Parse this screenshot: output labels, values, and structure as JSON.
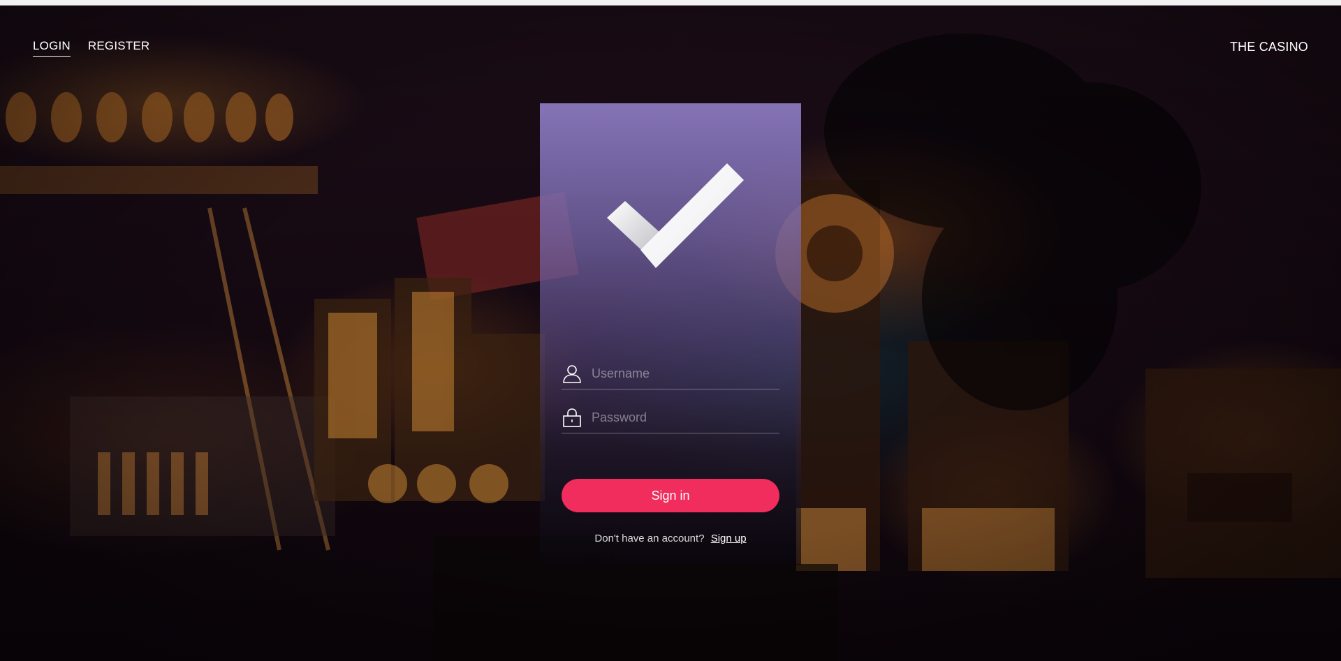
{
  "nav": {
    "login": "LOGIN",
    "register": "REGISTER"
  },
  "brand": "THE CASINO",
  "card": {
    "logo_icon": "checkmark-icon",
    "username": {
      "icon": "user-icon",
      "placeholder": "Username",
      "value": ""
    },
    "password": {
      "icon": "lock-icon",
      "placeholder": "Password",
      "value": ""
    },
    "signin_label": "Sign in",
    "signup_prompt": "Don't have an account?",
    "signup_link": "Sign up"
  },
  "colors": {
    "accent": "#f02d5c",
    "card_top": "#8e7cc4",
    "text": "#ffffff"
  }
}
